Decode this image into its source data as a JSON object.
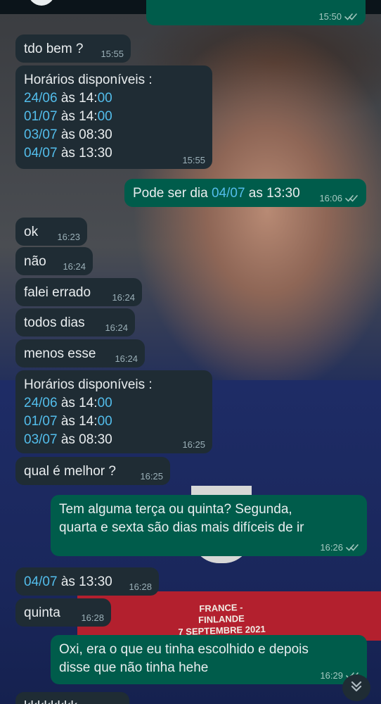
{
  "colors": {
    "incoming_bubble": "#1f2c34",
    "outgoing_bubble": "#005c4b",
    "link": "#53bdeb",
    "text": "#e9edef",
    "meta": "#9bb0b8"
  },
  "wallpaper": {
    "jersey_text_line1": "FRANCE - FINLANDE",
    "jersey_text_line2": "7 SEPTEMBRE 2021"
  },
  "messages": [
    {
      "dir": "out",
      "parts": [
        {
          "t": ""
        }
      ],
      "time": "15:50",
      "status": "read"
    },
    {
      "dir": "in",
      "parts": [
        {
          "t": "tdo bem ?"
        }
      ],
      "time": "15:55"
    },
    {
      "dir": "in",
      "parts": [
        {
          "t": "Horários disponíveis :\n"
        },
        {
          "t": "24/06",
          "link": true
        },
        {
          "t": " às 14:"
        },
        {
          "t": "00",
          "link": true
        },
        {
          "t": "\n"
        },
        {
          "t": "01/07",
          "link": true
        },
        {
          "t": " às 14:"
        },
        {
          "t": "00",
          "link": true
        },
        {
          "t": "\n"
        },
        {
          "t": "03/07",
          "link": true
        },
        {
          "t": " às 08:30\n"
        },
        {
          "t": "04/07",
          "link": true
        },
        {
          "t": " às 13:30"
        }
      ],
      "time": "15:55"
    },
    {
      "dir": "out",
      "parts": [
        {
          "t": "Pode ser dia "
        },
        {
          "t": "04/07",
          "link": true
        },
        {
          "t": " as 13:30"
        }
      ],
      "time": "16:06",
      "status": "read"
    },
    {
      "dir": "in",
      "parts": [
        {
          "t": "ok"
        }
      ],
      "time": "16:23"
    },
    {
      "dir": "in",
      "parts": [
        {
          "t": "não"
        }
      ],
      "time": "16:24"
    },
    {
      "dir": "in",
      "parts": [
        {
          "t": "falei errado"
        }
      ],
      "time": "16:24"
    },
    {
      "dir": "in",
      "parts": [
        {
          "t": "todos dias"
        }
      ],
      "time": "16:24"
    },
    {
      "dir": "in",
      "parts": [
        {
          "t": "menos esse"
        }
      ],
      "time": "16:24"
    },
    {
      "dir": "in",
      "parts": [
        {
          "t": "Horários disponíveis :\n"
        },
        {
          "t": "24/06",
          "link": true
        },
        {
          "t": " às 14:"
        },
        {
          "t": "00",
          "link": true
        },
        {
          "t": "\n"
        },
        {
          "t": "01/07",
          "link": true
        },
        {
          "t": " às 14:"
        },
        {
          "t": "00",
          "link": true
        },
        {
          "t": "\n"
        },
        {
          "t": "03/07",
          "link": true
        },
        {
          "t": " às 08:30"
        }
      ],
      "time": "16:25"
    },
    {
      "dir": "in",
      "parts": [
        {
          "t": "qual é melhor ?"
        }
      ],
      "time": "16:25"
    },
    {
      "dir": "out",
      "parts": [
        {
          "t": "Tem alguma terça ou quinta? Segunda,\nquarta e sexta são dias mais difíceis de ir"
        }
      ],
      "time": "16:26",
      "status": "read"
    },
    {
      "dir": "in",
      "parts": [
        {
          "t": "04/07",
          "link": true
        },
        {
          "t": " às 13:30"
        }
      ],
      "time": "16:28"
    },
    {
      "dir": "in",
      "parts": [
        {
          "t": "quinta"
        }
      ],
      "time": "16:28"
    },
    {
      "dir": "out",
      "parts": [
        {
          "t": "Oxi, era o que eu tinha escolhido e depois\ndisse que não tinha hehe"
        }
      ],
      "time": "16:29",
      "status": "read"
    },
    {
      "dir": "in",
      "parts": [
        {
          "t": "kkkkkkkk"
        }
      ],
      "time": ""
    }
  ],
  "scroll_button": {
    "icon": "double-chevron-down-icon"
  }
}
